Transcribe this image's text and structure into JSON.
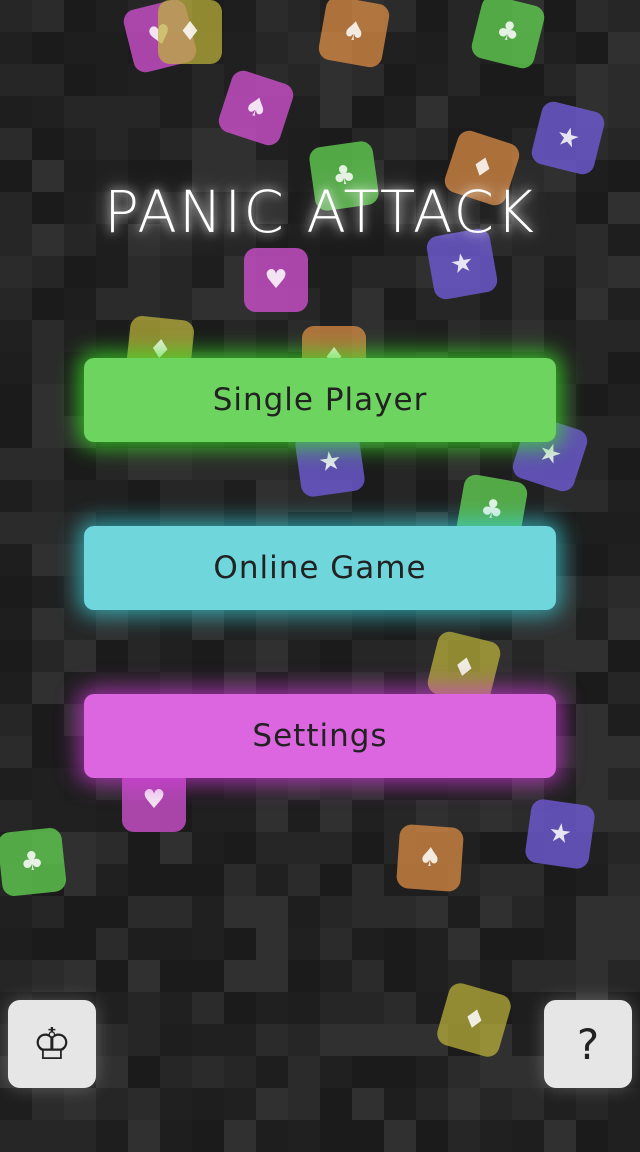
{
  "title": "PANIC ATTACK",
  "menu": {
    "single_player": "Single Player",
    "online_game": "Online Game",
    "settings": "Settings"
  },
  "corner": {
    "leaderboard_glyph": "♔",
    "help_glyph": "?"
  },
  "falling_tiles": [
    {
      "color": "magenta",
      "suit": "♥"
    },
    {
      "color": "olive",
      "suit": "♦"
    },
    {
      "color": "orange",
      "suit": "♠"
    },
    {
      "color": "green",
      "suit": "♣"
    },
    {
      "color": "magenta",
      "suit": "♠"
    },
    {
      "color": "purple",
      "suit": "★"
    },
    {
      "color": "green",
      "suit": "♣"
    },
    {
      "color": "orange",
      "suit": "♦"
    },
    {
      "color": "purple",
      "suit": "★"
    },
    {
      "color": "magenta",
      "suit": "♥"
    },
    {
      "color": "olive",
      "suit": "♦"
    },
    {
      "color": "orange",
      "suit": "♦"
    },
    {
      "color": "purple",
      "suit": "★"
    },
    {
      "color": "purple",
      "suit": "★"
    },
    {
      "color": "green",
      "suit": "♣"
    },
    {
      "color": "olive",
      "suit": "♦"
    },
    {
      "color": "magenta",
      "suit": "♥"
    },
    {
      "color": "green",
      "suit": "♣"
    },
    {
      "color": "orange",
      "suit": "♠"
    },
    {
      "color": "purple",
      "suit": "★"
    },
    {
      "color": "olive",
      "suit": "♦"
    }
  ],
  "colors": {
    "background": "#232323",
    "single_player": "#6ed460",
    "online_game": "#6fd6dc",
    "settings": "#db66e0"
  }
}
